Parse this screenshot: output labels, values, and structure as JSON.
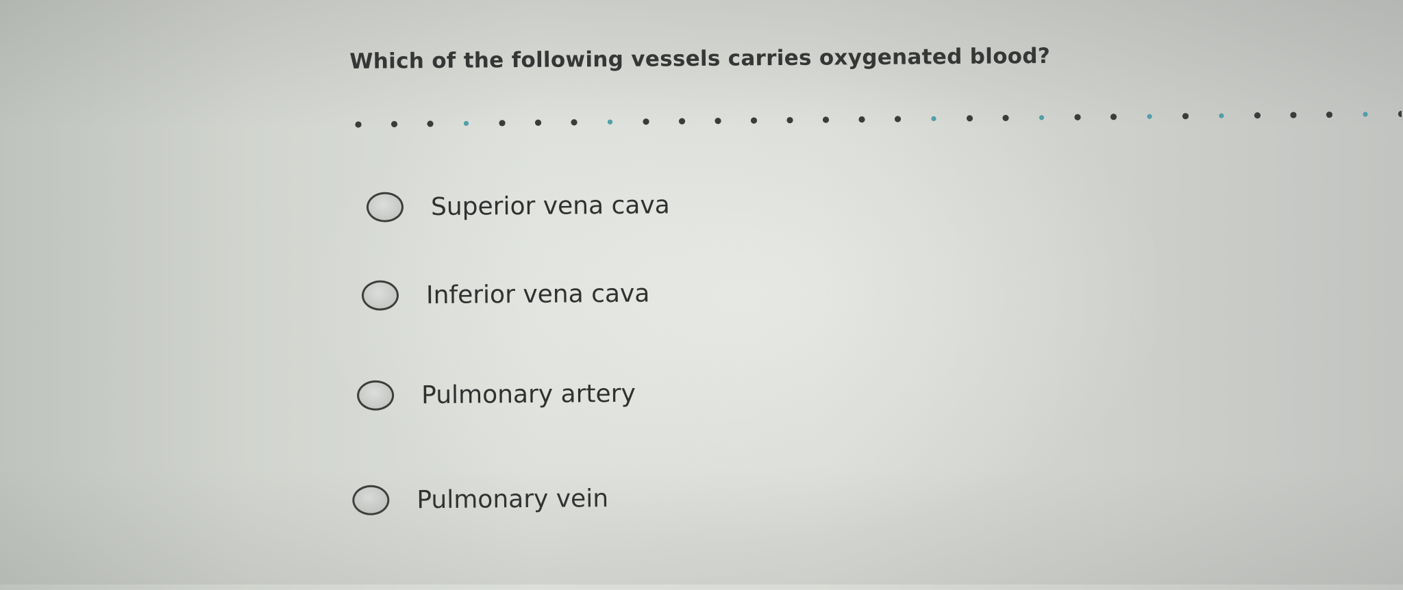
{
  "question": {
    "text": "Which of the following vessels carries oxygenated blood?"
  },
  "progress": {
    "dot_colors": [
      "#3a3c3b",
      "#4fa0a8"
    ],
    "answered_color": "#3a3c3b",
    "unanswered_color": "#4fa0a8"
  },
  "options": [
    {
      "label": "Superior vena cava",
      "selected": false
    },
    {
      "label": "Inferior vena cava",
      "selected": false
    },
    {
      "label": "Pulmonary artery",
      "selected": false
    },
    {
      "label": "Pulmonary vein",
      "selected": false
    }
  ]
}
